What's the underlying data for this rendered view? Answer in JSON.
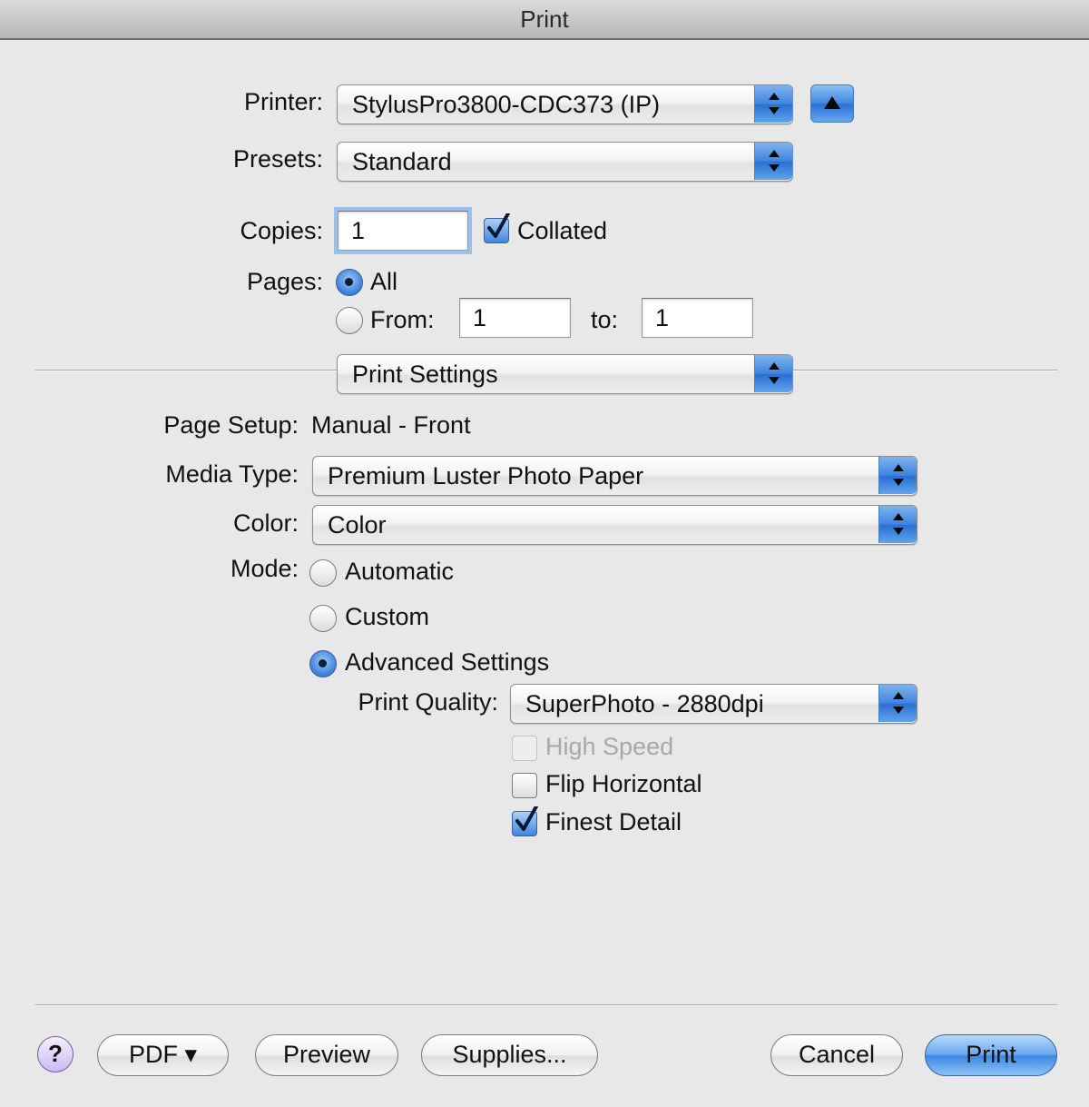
{
  "window": {
    "title": "Print"
  },
  "printer": {
    "label": "Printer:",
    "value": "StylusPro3800-CDC373 (IP)"
  },
  "presets": {
    "label": "Presets:",
    "value": "Standard"
  },
  "copies": {
    "label": "Copies:",
    "value": "1",
    "collated_label": "Collated",
    "collated_checked": true
  },
  "pages": {
    "label": "Pages:",
    "all_label": "All",
    "from_label": "From:",
    "from_value": "1",
    "to_label": "to:",
    "to_value": "1",
    "selected": "All"
  },
  "panel": {
    "value": "Print Settings"
  },
  "settings": {
    "page_setup_label": "Page Setup:",
    "page_setup_value": "Manual - Front",
    "media_type_label": "Media Type:",
    "media_type_value": "Premium Luster Photo Paper",
    "color_label": "Color:",
    "color_value": "Color",
    "mode_label": "Mode:",
    "modes": [
      "Automatic",
      "Custom",
      "Advanced Settings"
    ],
    "mode_selected": "Advanced Settings",
    "print_quality_label": "Print Quality:",
    "print_quality_value": "SuperPhoto - 2880dpi",
    "high_speed_label": "High Speed",
    "high_speed_enabled": false,
    "flip_horizontal_label": "Flip Horizontal",
    "flip_horizontal_checked": false,
    "finest_detail_label": "Finest Detail",
    "finest_detail_checked": true
  },
  "buttons": {
    "help": "?",
    "pdf": "PDF ▾",
    "preview": "Preview",
    "supplies": "Supplies...",
    "cancel": "Cancel",
    "print": "Print"
  },
  "colors": {
    "accent": "#3f84e0",
    "window_bg": "#e8e8e8",
    "help_button": "#cbbaf2"
  },
  "icons": {
    "popup_arrows": "up-down-arrows-icon",
    "disclosure": "triangle-up-icon",
    "checkmark": "checkmark-icon"
  }
}
